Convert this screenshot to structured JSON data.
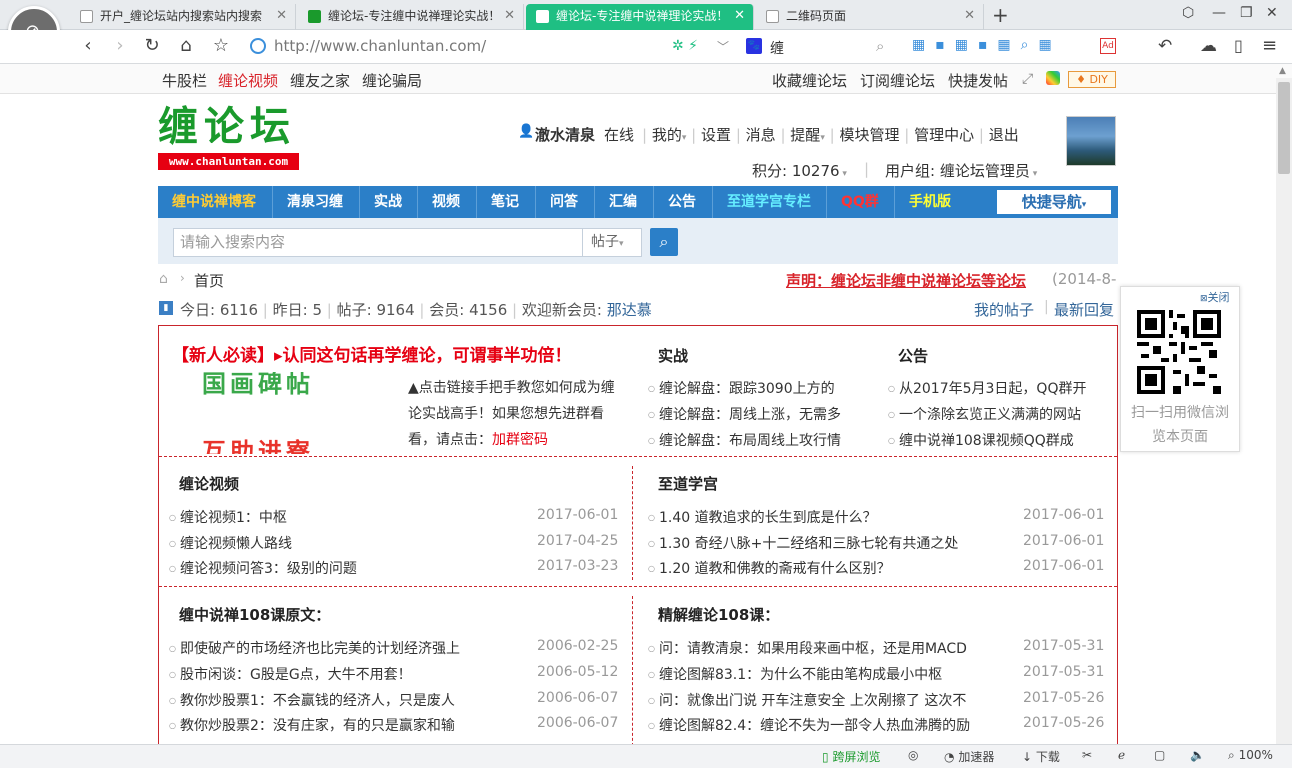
{
  "tabs": [
    {
      "title": "开户_缠论坛站内搜索站内搜索"
    },
    {
      "title": "缠论坛-专注缠中说禅理论实战！"
    },
    {
      "title": "缠论坛-专注缠中说禅理论实战！"
    },
    {
      "title": "二维码页面"
    }
  ],
  "tab_new": "+",
  "address": {
    "url": "http://www.chanluntan.com/",
    "search_value": "缠"
  },
  "bookmarks": {
    "left": [
      "牛股栏",
      "缠论视频",
      "缠友之家",
      "缠论骗局"
    ],
    "right": [
      "收藏缠论坛",
      "订阅缠论坛",
      "快捷发帖"
    ],
    "diy": "DIY"
  },
  "site": {
    "logo_text": "缠论坛",
    "logo_url": "www.chanluntan.com"
  },
  "user": {
    "name": "澈水清泉",
    "online": "在线",
    "menu": [
      "我的",
      "设置",
      "消息",
      "提醒",
      "模块管理",
      "管理中心",
      "退出"
    ],
    "points_label": "积分: 10276",
    "group_label": "用户组: 缠论坛管理员"
  },
  "nav": {
    "items": [
      "缠中说禅博客",
      "清泉习缠",
      "实战",
      "视频",
      "笔记",
      "问答",
      "汇编",
      "公告",
      "至道学宫专栏",
      "QQ群",
      "手机版"
    ],
    "quick": "快捷导航"
  },
  "search": {
    "placeholder": "请输入搜索内容",
    "type": "帖子"
  },
  "breadcrumb": {
    "home": "首页"
  },
  "notice": {
    "text": "声明：缠论坛非缠中说禅论坛等论坛",
    "date": "(2014-8-"
  },
  "stats": {
    "today": "今日: 6116",
    "yesterday": "昨日: 5",
    "posts": "帖子: 9164",
    "members": "会员: 4156",
    "welcome": "欢迎新会员:",
    "new_member": "那达慕"
  },
  "mylinks": {
    "my_posts": "我的帖子",
    "latest": "最新回复"
  },
  "newbie": {
    "title": "【新人必读】▸认同这句话再学缠论，可谓事半功倍！",
    "img_top": "国画碑帖",
    "img_bottom": "互助进寮",
    "text": "▲点击链接手把手教您如何成为缠论实战高手！如果您想先进群看看，请点击：",
    "link": "加群密码"
  },
  "shizhan": {
    "title": "实战",
    "items": [
      "缠论解盘：跟踪3090上方的",
      "缠论解盘：周线上涨，无需多",
      "缠论解盘：布局周线上攻行情"
    ]
  },
  "gonggao": {
    "title": "公告",
    "items": [
      "从2017年5月3日起，QQ群开",
      "一个涤除玄览正义满满的网站",
      "缠中说禅108课视频QQ群成"
    ]
  },
  "video": {
    "title": "缠论视频",
    "items": [
      {
        "t": "缠论视频1：中枢",
        "d": "2017-06-01"
      },
      {
        "t": "缠论视频懒人路线",
        "d": "2017-04-25"
      },
      {
        "t": "缠论视频问答3：级别的问题",
        "d": "2017-03-23"
      }
    ]
  },
  "zhidao": {
    "title": "至道学宫",
    "items": [
      {
        "t": "1.40 道教追求的长生到底是什么？",
        "d": "2017-06-01"
      },
      {
        "t": "1.30 奇经八脉+十二经络和三脉七轮有共通之处",
        "d": "2017-06-01"
      },
      {
        "t": "1.20 道教和佛教的斋戒有什么区别？",
        "d": "2017-06-01"
      }
    ]
  },
  "yuanwen": {
    "title": "缠中说禅108课原文：",
    "items": [
      {
        "t": "即使破产的市场经济也比完美的计划经济强上",
        "d": "2006-02-25"
      },
      {
        "t": "股市闲谈：G股是G点，大牛不用套！",
        "d": "2006-05-12"
      },
      {
        "t": "教你炒股票1：不会赢钱的经济人，只是废人",
        "d": "2006-06-07"
      },
      {
        "t": "教你炒股票2：没有庄家，有的只是赢家和输",
        "d": "2006-06-07"
      }
    ]
  },
  "jingjie": {
    "title": "精解缠论108课：",
    "items": [
      {
        "t": "问：请教清泉：如果用段来画中枢，还是用MACD",
        "d": "2017-05-31"
      },
      {
        "t": "缠论图解83.1：为什么不能由笔构成最小中枢",
        "d": "2017-05-31"
      },
      {
        "t": "问：就像出门说 开车注意安全 上次剐擦了 这次不",
        "d": "2017-05-26"
      },
      {
        "t": "缠论图解82.4：缠论不失为一部令人热血沸腾的励",
        "d": "2017-05-26"
      }
    ]
  },
  "qr": {
    "close": "关闭",
    "caption": "扫一扫用微信浏览本页面"
  },
  "status": {
    "crossscreen": "跨屏浏览",
    "accelerator": "加速器",
    "download": "下载",
    "zoom": "100%"
  },
  "colors": {
    "accent": "#1fbf83",
    "nav_blue": "#2b7fc8",
    "red": "#d8232a",
    "green_logo": "#1a9a2c"
  }
}
